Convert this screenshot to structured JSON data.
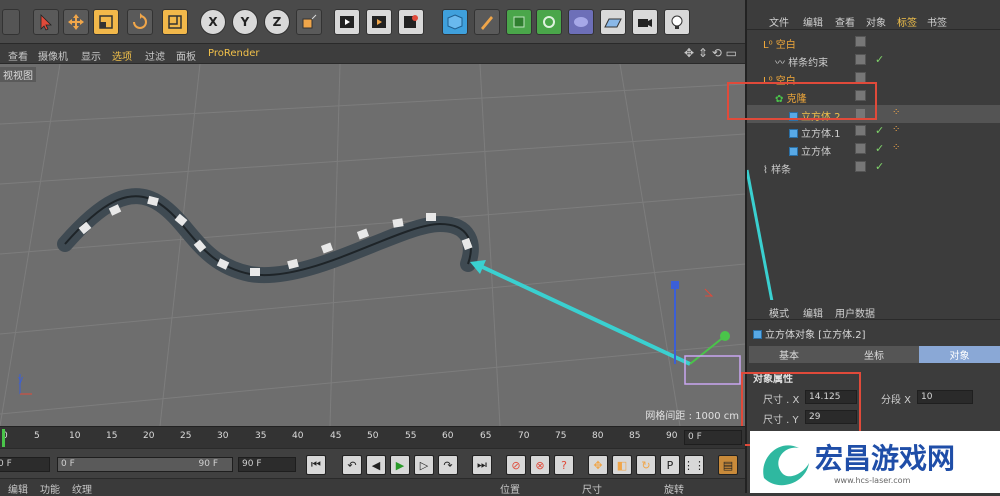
{
  "viewport": {
    "menu": [
      "查看",
      "摄像机",
      "显示",
      "选项",
      "过滤",
      "面板",
      "ProRender"
    ],
    "label": "视视图",
    "grid_spacing": "网格间距 : 1000 cm"
  },
  "toolbar": {
    "axis_x": "X",
    "axis_y": "Y",
    "axis_z": "Z"
  },
  "object_manager": {
    "menu": [
      "文件",
      "编辑",
      "查看",
      "对象",
      "标签",
      "书签"
    ],
    "objects": [
      {
        "name": "空白",
        "indent": 1
      },
      {
        "name": "样条约束",
        "indent": 2
      },
      {
        "name": "空白",
        "indent": 1
      },
      {
        "name": "克隆",
        "indent": 2
      },
      {
        "name": "立方体.2",
        "indent": 3
      },
      {
        "name": "立方体.1",
        "indent": 3
      },
      {
        "name": "立方体",
        "indent": 3
      },
      {
        "name": "样条",
        "indent": 1
      }
    ]
  },
  "attributes": {
    "menu": [
      "模式",
      "编辑",
      "用户数据"
    ],
    "title": "立方体对象 [立方体.2]",
    "tabs": [
      "基本",
      "坐标",
      "对象"
    ],
    "section": "对象属性",
    "size_x_label": "尺寸 . X",
    "size_x_value": "14.125",
    "seg_x_label": "分段 X",
    "seg_x_value": "10",
    "size_y_label": "尺寸 . Y",
    "size_y_value": "29"
  },
  "timeline": {
    "ticks": [
      "0",
      "5",
      "10",
      "15",
      "20",
      "25",
      "30",
      "35",
      "40",
      "45",
      "50",
      "55",
      "60",
      "65",
      "70",
      "75",
      "80",
      "85",
      "90"
    ],
    "current_frame": "0 F"
  },
  "playback": {
    "start": "0 F",
    "range_start": "0 F",
    "range_end": "90 F",
    "end": "90 F"
  },
  "bottom_menu": [
    "编辑",
    "功能",
    "纹理"
  ],
  "coord_menu": [
    "位置",
    "尺寸",
    "旋转"
  ],
  "watermark": {
    "text": "宏昌游戏网",
    "url": "www.hcs-laser.com"
  }
}
